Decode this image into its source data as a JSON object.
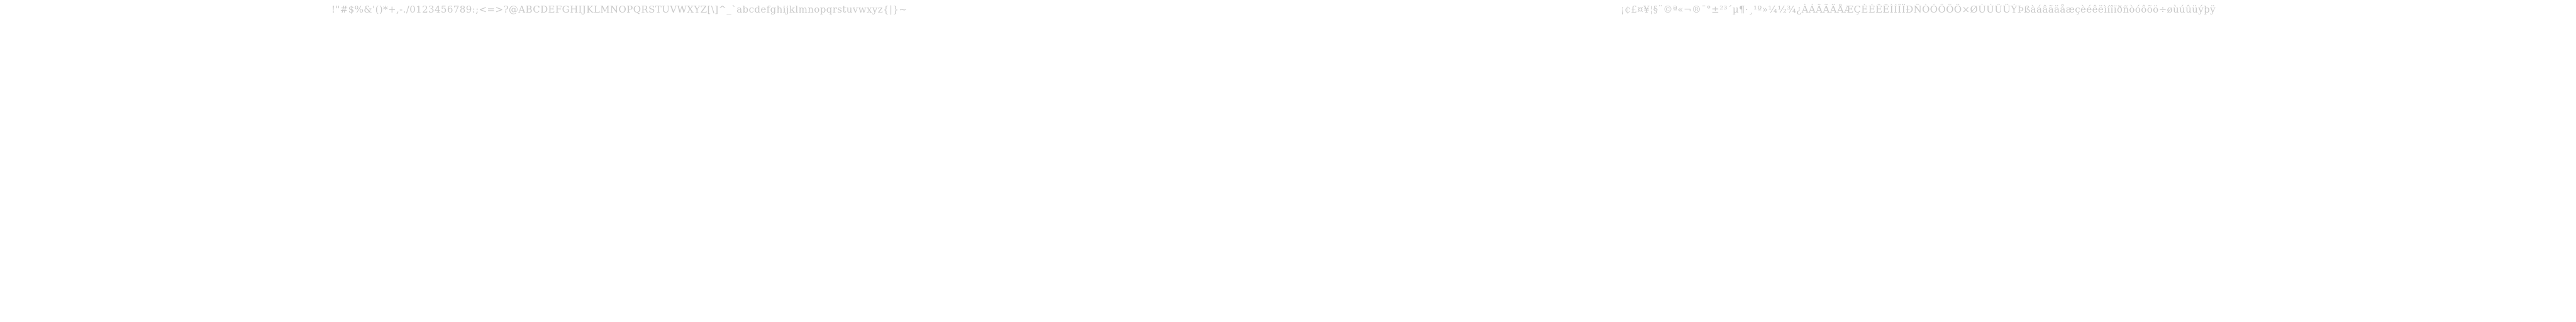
{
  "atlas": {
    "ascii_row": "!\"#$%&'()*+,-./0123456789:;<=>?@ABCDEFGHIJKLMNOPQRSTUVWXYZ[\\]^_`abcdefghijklmnopqrstuvwxyz{|}~",
    "latin1_row": "¡¢£¤¥¦§¨©ª«¬®¯°±²³´µ¶·¸¹º»¼½¾¿ÀÁÂÃÄÅÆÇÈÉÊËÌÍÎÏÐÑÒÓÔÕÖ×ØÙÚÛÜÝÞßàáâãäåæçèéêëìíîïðñòóôõö÷øùúûüýþÿ",
    "text_color": "#c9c9c9",
    "background_color": "#ffffff"
  }
}
